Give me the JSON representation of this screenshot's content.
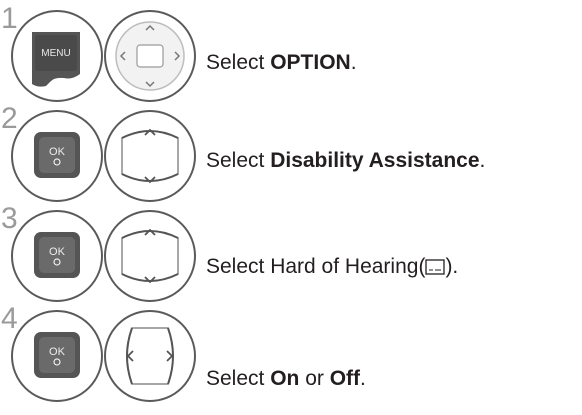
{
  "steps": [
    {
      "number": "1",
      "icons": [
        "menu-button-icon",
        "navigation-dpad-center-icon"
      ],
      "menu_button_label": "MENU",
      "prefix": "Select ",
      "bold": "OPTION",
      "suffix": "."
    },
    {
      "number": "2",
      "icons": [
        "ok-button-icon",
        "navigation-up-down-icon"
      ],
      "ok_button_label": "OK",
      "prefix": "Select ",
      "bold": "Disability Assistance",
      "suffix": "."
    },
    {
      "number": "3",
      "icons": [
        "ok-button-icon",
        "navigation-up-down-icon"
      ],
      "ok_button_label": "OK",
      "prefix": "Select Hard of Hearing(",
      "inline_icon": "closed-caption-icon",
      "suffix": ")."
    },
    {
      "number": "4",
      "icons": [
        "ok-button-icon",
        "navigation-left-right-icon"
      ],
      "ok_button_label": "OK",
      "prefix": "Select ",
      "bold": "On",
      "middle": " or ",
      "bold2": "Off",
      "suffix": "."
    }
  ],
  "colors": {
    "text": "#231f20",
    "step_number": "#9a9a9a",
    "button_dark": "#555555",
    "button_light": "#f2f2f2",
    "outline": "#5a5a5a"
  }
}
